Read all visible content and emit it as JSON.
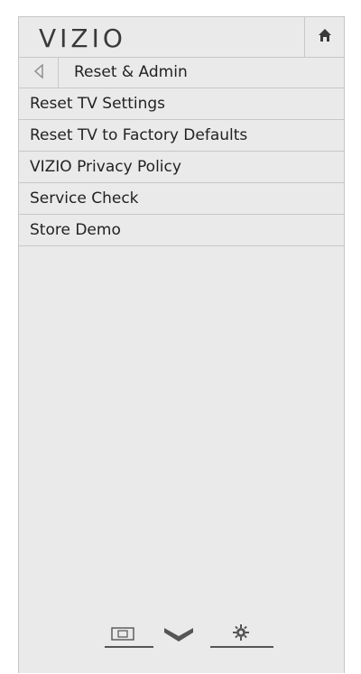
{
  "header": {
    "logo_text": "VIZIO",
    "home_icon": "home-icon"
  },
  "title_row": {
    "back_icon": "chevron-left-icon",
    "title": "Reset & Admin"
  },
  "menu": {
    "items": [
      {
        "label": "Reset TV Settings"
      },
      {
        "label": "Reset TV to Factory Defaults"
      },
      {
        "label": "VIZIO Privacy Policy"
      },
      {
        "label": "Service Check"
      },
      {
        "label": "Store Demo"
      }
    ]
  },
  "footer": {
    "icons": [
      "picture-mode-icon",
      "chevron-down-icon",
      "gear-icon"
    ]
  },
  "colors": {
    "panel_bg": "#eaeaea",
    "divider": "#c8c8c8",
    "text": "#222222"
  }
}
